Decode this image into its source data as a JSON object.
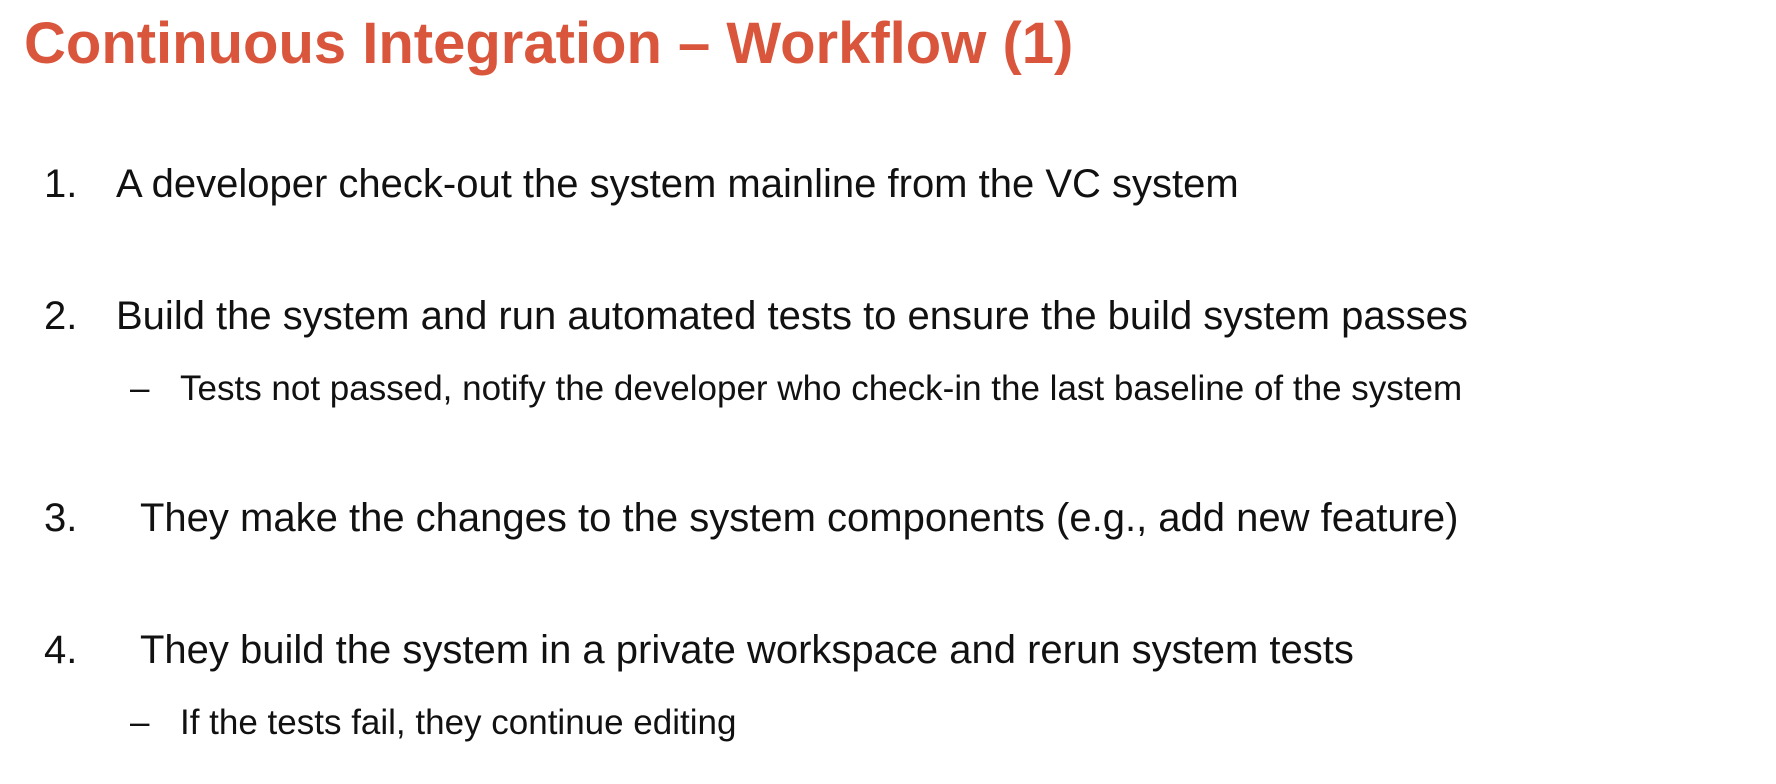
{
  "slide": {
    "title": "Continuous Integration – Workflow (1)",
    "items": [
      {
        "number": "1.",
        "text": "A developer check-out the system mainline from the VC system"
      },
      {
        "number": "2.",
        "text": "Build the system and run automated tests to ensure the build system passes",
        "sub": {
          "marker": "–",
          "text": "Tests not passed, notify the developer who check-in the last baseline of the system"
        }
      },
      {
        "number": "3.",
        "text": "They make the changes to the system components (e.g., add new feature)"
      },
      {
        "number": "4.",
        "text": "They build the system in a private workspace and rerun system tests",
        "sub": {
          "marker": "–",
          "text": "If the tests fail, they continue editing"
        }
      }
    ],
    "colors": {
      "title": "#d9553b",
      "body_text": "#111111",
      "background": "#ffffff"
    }
  }
}
